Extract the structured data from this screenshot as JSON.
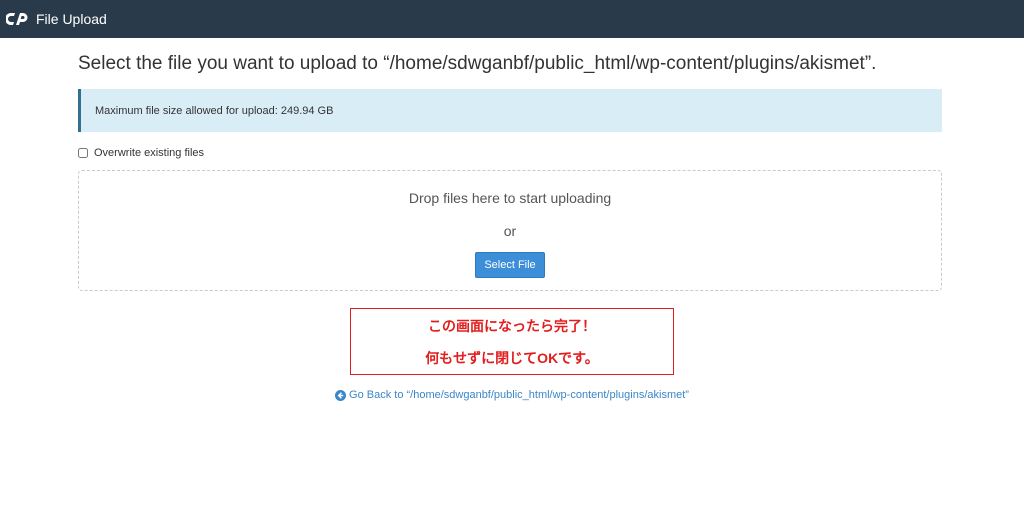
{
  "header": {
    "logo_icon": "cpanel-logo-icon",
    "title": "File Upload",
    "background": "#293a4a"
  },
  "main": {
    "heading": "Select the file you want to upload to “/home/sdwganbf/public_html/wp-content/plugins/akismet”.",
    "info": {
      "text": "Maximum file size allowed for upload: 249.94 GB",
      "background": "#d9edf7"
    },
    "overwrite": {
      "label": "Overwrite existing files",
      "checked": false
    },
    "dropzone": {
      "text": "Drop files here to start uploading",
      "or_text": "or",
      "button_label": "Select File",
      "button_color": "#3d8ed8"
    },
    "annotation": {
      "line1": "この画面になったら完了！",
      "line2": "何もせずに閉じてOKです。",
      "color": "#e21d1d"
    },
    "go_back": {
      "icon": "arrow-circle-left-icon",
      "label": "Go Back to “/home/sdwganbf/public_html/wp-content/plugins/akismet”",
      "color": "#3b86c8"
    }
  }
}
